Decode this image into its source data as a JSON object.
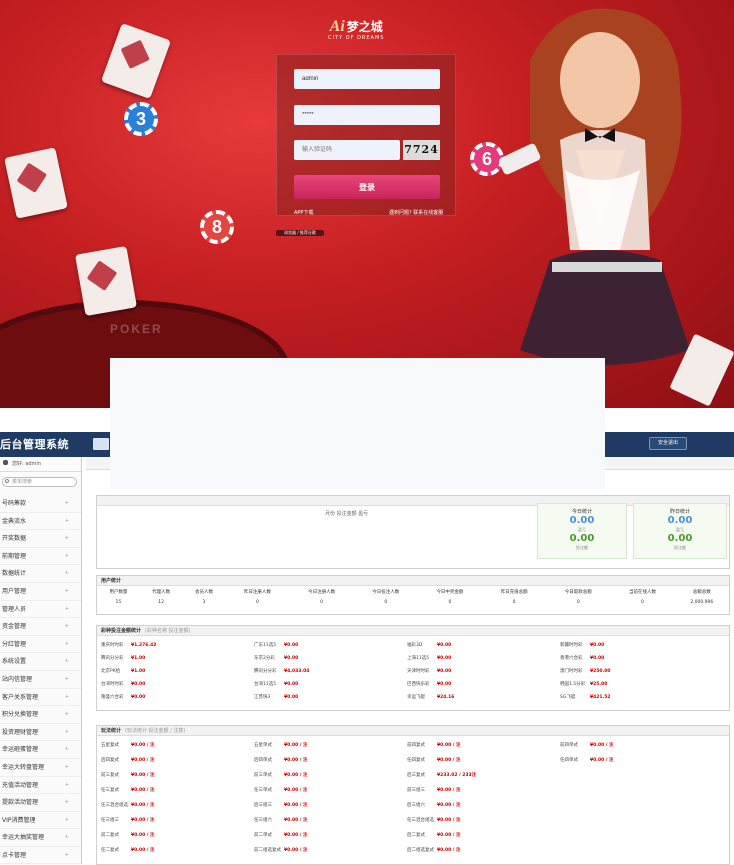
{
  "login": {
    "logo_mark": "Ai",
    "brand_cn": "梦之城",
    "brand_en": "CITY OF DREAMS",
    "username": "admin",
    "password": "*****",
    "captcha_placeholder": "输入验证码",
    "captcha": "7724",
    "button": "登录",
    "app_download": "APP下载",
    "forgot": "遇到问题? 联系在线客服",
    "browser_hint": "浏览器 / 推荐谷歌",
    "chip_numbers": [
      "3",
      "8",
      "6"
    ],
    "table_text": "POKER"
  },
  "admin": {
    "title": "后台管理系统",
    "user": "您好: admin",
    "search_placeholder": "菜单搜索",
    "logout": "安全退出",
    "menu": [
      "号码筹款",
      "金典流水",
      "开奖数据",
      "前期管理",
      "数据统计",
      "用户管理",
      "管理人员",
      "资金管理",
      "分红管理",
      "系统设置",
      "站内信管理",
      "客户关系管理",
      "积分兑换管理",
      "投资理财管理",
      "幸运砸蛋管理",
      "幸运大转盘管理",
      "充值活动管理",
      "提款活动管理",
      "VIP消费管理",
      "幸运大抽奖管理",
      "点卡管理"
    ],
    "overview": {
      "center_text": "月份 投注金额 盈亏",
      "today": {
        "title": "今日统计",
        "v1": "0.00",
        "l1": "盈亏",
        "v2": "0.00",
        "l2": "投注额"
      },
      "yesterday": {
        "title": "昨日统计",
        "v1": "0.00",
        "l1": "盈亏",
        "v2": "0.00",
        "l2": "投注额"
      }
    },
    "user_stats": {
      "header": "用户统计",
      "cols": [
        "用户数量",
        "代理人数",
        "会员人数",
        "昨日注册人数",
        "今日注册人数",
        "今日投注人数",
        "今日中奖金额",
        "昨日充值总额",
        "今日取款总额",
        "当前在线人数",
        "总额总数"
      ],
      "vals": [
        "15",
        "12",
        "3",
        "0",
        "0",
        "0",
        "0",
        "0",
        "0",
        "0",
        "2,000,996"
      ]
    },
    "lottery_stats": {
      "header": "彩种投注金额统计",
      "sub": "(彩种名称  投注金额)",
      "cols": [
        [
          [
            "重庆时时彩",
            "¥1,276.42"
          ],
          [
            "腾讯分分彩",
            "¥1.00"
          ],
          [
            "北京PK拾",
            "¥1.00"
          ],
          [
            "台湾时时彩",
            "¥0.00"
          ],
          [
            "隆盛六合彩",
            "¥0.00"
          ]
        ],
        [
          [
            "广东11选5",
            "¥0.00"
          ],
          [
            "东京2分彩",
            "¥0.00"
          ],
          [
            "腾讯分分彩",
            "¥4,033.04"
          ],
          [
            "台湾11选5",
            "¥0.00"
          ],
          [
            "江苏快3",
            "¥0.00"
          ]
        ],
        [
          [
            "福彩3D",
            "¥0.00"
          ],
          [
            "上海11选5",
            "¥0.00"
          ],
          [
            "天津时时彩",
            "¥0.00"
          ],
          [
            "巴西快乐彩",
            "¥0.00"
          ],
          [
            "幸运飞艇",
            "¥24.16"
          ]
        ],
        [
          [
            "新疆时时彩",
            "¥0.00"
          ],
          [
            "香港六合彩",
            "¥0.00"
          ],
          [
            "澳门时时彩",
            "¥250.00"
          ],
          [
            "韩国1.5分彩",
            "¥25.00"
          ],
          [
            "SG飞艇",
            "¥421.52"
          ]
        ]
      ]
    },
    "play_stats": {
      "header": "玩法统计",
      "sub": "(玩法统计  投注金额 / 注数)",
      "cols": [
        [
          [
            "五星复式",
            "¥0.00 / 注"
          ],
          [
            "后四复式",
            "¥0.00 / 注"
          ],
          [
            "前三复式",
            "¥0.00 / 注"
          ],
          [
            "任三复式",
            "¥0.00 / 注"
          ],
          [
            "任三混合组选",
            "¥0.00 / 注"
          ],
          [
            "任三组三",
            "¥0.00 / 注"
          ],
          [
            "前二复式",
            "¥0.00 / 注"
          ],
          [
            "任二复式",
            "¥0.00 / 注"
          ]
        ],
        [
          [
            "五星单式",
            "¥0.00 / 注"
          ],
          [
            "后四单式",
            "¥0.00 / 注"
          ],
          [
            "前三单式",
            "¥0.00 / 注"
          ],
          [
            "任三单式",
            "¥0.00 / 注"
          ],
          [
            "后三组三",
            "¥0.00 / 注"
          ],
          [
            "任三组六",
            "¥0.00 / 注"
          ],
          [
            "前二单式",
            "¥0.00 / 注"
          ],
          [
            "前二组选复式",
            "¥0.00 / 注"
          ]
        ],
        [
          [
            "前四复式",
            "¥0.00 / 注"
          ],
          [
            "任四复式",
            "¥0.00 / 注"
          ],
          [
            "后三复式",
            "¥233.02 / 233注"
          ],
          [
            "前三组三",
            "¥0.00 / 注"
          ],
          [
            "后三组六",
            "¥0.00 / 注"
          ],
          [
            "任三混合组选",
            "¥0.00 / 注"
          ],
          [
            "后二复式",
            "¥0.00 / 注"
          ],
          [
            "后二组选复式",
            "¥0.00 / 注"
          ]
        ],
        [
          [
            "前四单式",
            "¥0.00 / 注"
          ],
          [
            "任四单式",
            "¥0.00 / 注"
          ]
        ]
      ]
    }
  },
  "colors": {
    "accent": "#1f3b63",
    "brand_red": "#c51f22",
    "button_pink": "#d9336b",
    "money_red": "#cc0000",
    "stat_blue": "#4a90d9",
    "stat_green": "#4a9a2a"
  }
}
